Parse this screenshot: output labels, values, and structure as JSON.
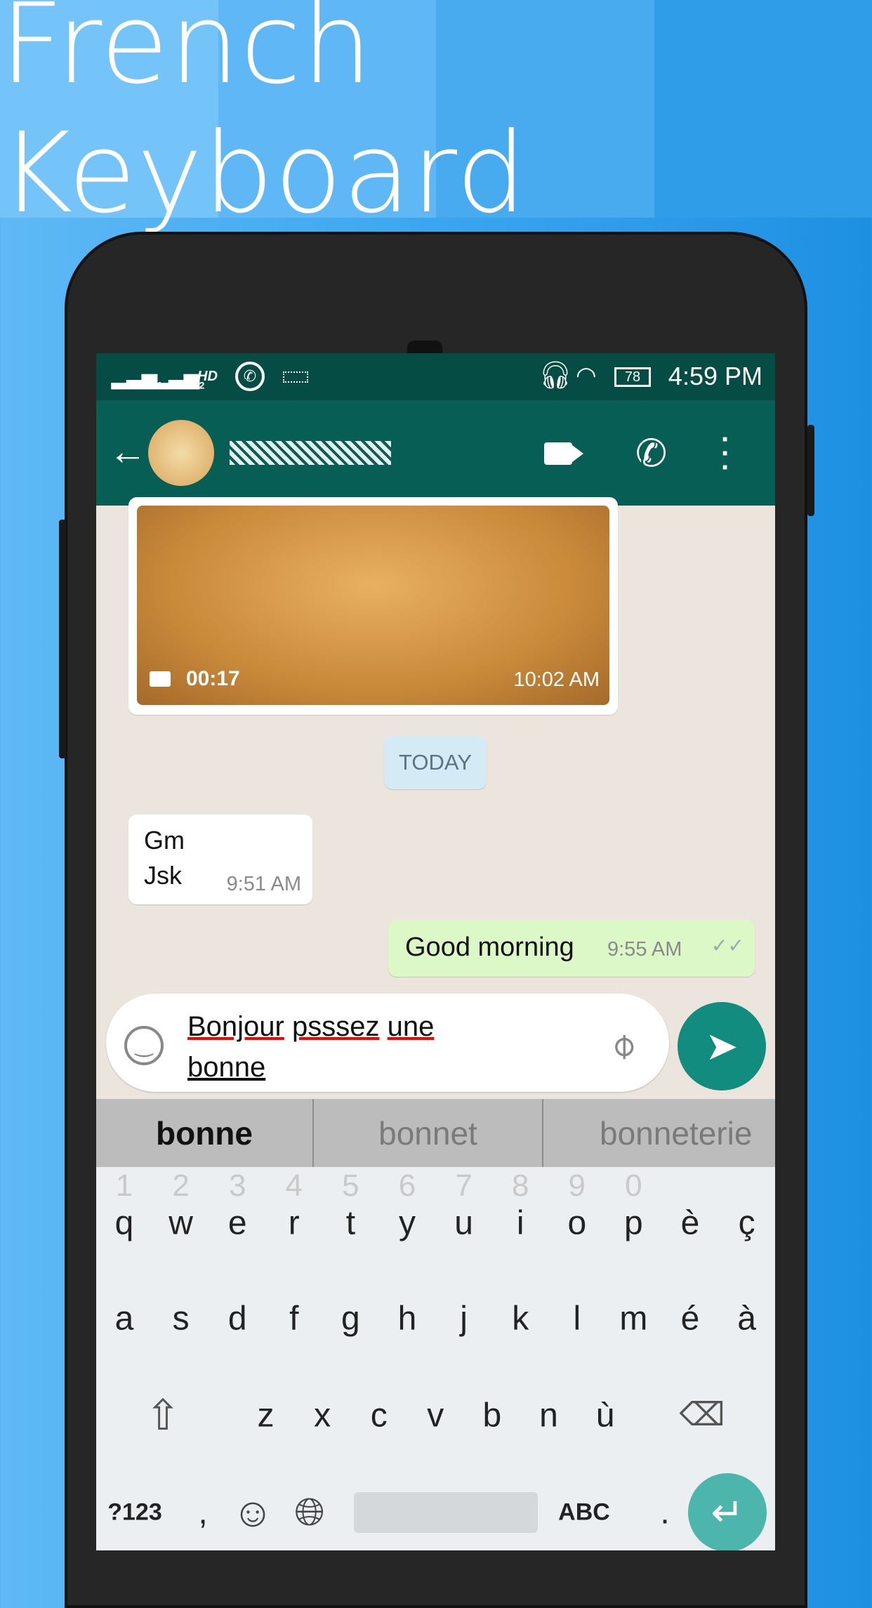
{
  "banner": {
    "title": "French Keyboard"
  },
  "colors": {
    "status_bar": "#054d44",
    "app_bar": "#075e54",
    "accent": "#128c7e",
    "enter_key": "#4db6ac",
    "outgoing_bubble": "#dcf8c6"
  },
  "status_bar": {
    "sim1": "1",
    "sim2": "2",
    "hd": "HD",
    "battery": "78",
    "time": "4:59 PM",
    "icons": [
      "signal-icon",
      "signal-icon",
      "whatsapp-icon",
      "keyboard-icon",
      "headset-icon",
      "wifi-icon",
      "battery-icon"
    ]
  },
  "app_bar": {
    "icons": [
      "back-arrow-icon",
      "avatar",
      "video-call-icon",
      "phone-icon",
      "more-vert-icon"
    ]
  },
  "chat": {
    "video_message": {
      "duration": "00:17",
      "time": "10:02 AM"
    },
    "date_divider": "TODAY",
    "incoming": {
      "lines": [
        "Gm",
        "Jsk"
      ],
      "time": "9:51 AM"
    },
    "outgoing": {
      "text": "Good morning",
      "time": "9:55 AM"
    }
  },
  "composer": {
    "line1_words": [
      "Bonjour",
      "psssez",
      "une"
    ],
    "line2": "bonne"
  },
  "suggestions": [
    "bonne",
    "bonnet",
    "bonneterie"
  ],
  "keyboard": {
    "numbers": [
      "1",
      "2",
      "3",
      "4",
      "5",
      "6",
      "7",
      "8",
      "9",
      "0"
    ],
    "row1": [
      "q",
      "w",
      "e",
      "r",
      "t",
      "y",
      "u",
      "i",
      "o",
      "p",
      "è",
      "ç"
    ],
    "row2": [
      "a",
      "s",
      "d",
      "f",
      "g",
      "h",
      "j",
      "k",
      "l",
      "m",
      "é",
      "à"
    ],
    "row3": [
      "z",
      "x",
      "c",
      "v",
      "b",
      "n",
      "ù"
    ],
    "symbols_key": "?123",
    "comma": ",",
    "abc_key": "ABC",
    "period": "."
  }
}
